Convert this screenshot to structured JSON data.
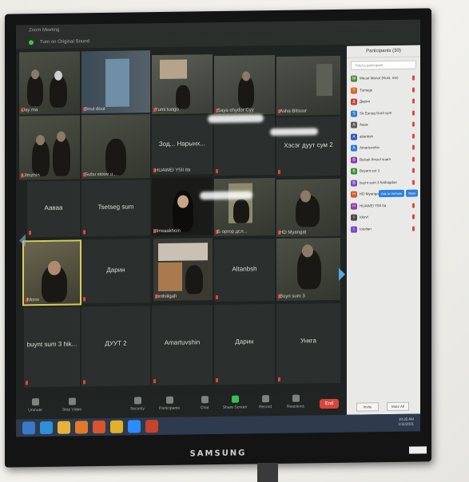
{
  "screen": {
    "title_text": "Zoom Meeting",
    "banner_text": "Turn on Original Sound"
  },
  "gallery": {
    "video_tiles": [
      {
        "name": "Jay ma"
      },
      {
        "name": "Bout dout"
      },
      {
        "name": "Tumi tungo"
      },
      {
        "name": "Saya ehydor Cyy"
      },
      {
        "name": "Asha Bitsuur"
      },
      {
        "name": "Ulmzhin"
      },
      {
        "name": "Subu stoov u..."
      },
      {
        "name": "HUAWEI Y5II Ita"
      },
      {
        "name": "Ilmsaakhoin"
      },
      {
        "name": "Б оргор дсл..."
      },
      {
        "name": "HD Myangat"
      },
      {
        "name": "Mono"
      },
      {
        "name": "Iinthiilgah"
      },
      {
        "name": "Buyn sum 3"
      }
    ],
    "name_tiles": [
      {
        "name": "Хэсэг дуут сум 2"
      },
      {
        "name": "Ааваа"
      },
      {
        "name": "Tsetseg sum"
      },
      {
        "name": "Дарин"
      },
      {
        "name": "Altanbsh"
      },
      {
        "name": "buynt sum 3 hik..."
      },
      {
        "name": "ДУУТ 2"
      },
      {
        "name": "Amartuvshin"
      },
      {
        "name": "Дарин"
      },
      {
        "name": "Ункгa"
      }
    ],
    "overlay_caption": "Зод... Нарынх..."
  },
  "toolbar": {
    "items": [
      {
        "label": "Unmute",
        "icon": "microphone-icon"
      },
      {
        "label": "Stop Video",
        "icon": "video-camera-icon"
      },
      {
        "label": "Security",
        "icon": "shield-icon"
      },
      {
        "label": "Participants",
        "icon": "participants-icon",
        "count": "30"
      },
      {
        "label": "Chat",
        "icon": "chat-icon"
      },
      {
        "label": "Share Screen",
        "icon": "share-screen-icon"
      },
      {
        "label": "Record",
        "icon": "record-icon"
      },
      {
        "label": "Reactions",
        "icon": "reactions-icon"
      }
    ],
    "end_label": "End"
  },
  "participants": {
    "title": "Participants (30)",
    "search_placeholder": "Find a participant",
    "ask_unmute_label": "Ask to Unmute",
    "more_label": "More",
    "list": [
      {
        "initial": "M",
        "name": "Mnout Monot (Host, me)",
        "color": "#4f8b3c"
      },
      {
        "initial": "T",
        "name": "Tumegs",
        "color": "#d2692a"
      },
      {
        "initial": "Д",
        "name": "Дарин",
        "color": "#c23d3a"
      },
      {
        "initial": "S",
        "name": "Sh Eunog Gorit sym",
        "color": "#2f7ad3"
      },
      {
        "initial": "A",
        "name": "Aaua",
        "color": "#5a5a5a"
      },
      {
        "initial": "A",
        "name": "altanbsh",
        "color": "#2f5ab8"
      },
      {
        "initial": "A",
        "name": "Amartuvshin",
        "color": "#2f7ad3"
      },
      {
        "initial": "B",
        "name": "Bulsuk Ihnzel suam",
        "color": "#8b3da6"
      },
      {
        "initial": "B",
        "name": "Buyant sur 1",
        "color": "#3d8f3a"
      },
      {
        "initial": "B",
        "name": "buynt sum 3 hathagdas",
        "color": "#7a4cc0"
      },
      {
        "initial": "H",
        "name": "HD Myangat",
        "color": "#d05a2a"
      },
      {
        "initial": "H",
        "name": "HUAWEI Y5II Ita",
        "color": "#8b3da6"
      },
      {
        "initial": "I",
        "name": "Idsrvl",
        "color": "#4a4a4a"
      },
      {
        "initial": "I",
        "name": "Iotofian",
        "color": "#7a4cc0"
      }
    ],
    "invite_label": "Invite",
    "mute_all_label": "Mute All"
  },
  "taskbar": {
    "apps": [
      {
        "icon": "windows-start-icon",
        "color": "#3a78c9"
      },
      {
        "icon": "internet-explorer-icon",
        "color": "#2f8fd8"
      },
      {
        "icon": "file-explorer-icon",
        "color": "#e6b23a"
      },
      {
        "icon": "media-player-icon",
        "color": "#e07a2a"
      },
      {
        "icon": "firefox-icon",
        "color": "#d9542b"
      },
      {
        "icon": "chrome-icon",
        "color": "#e0b12a"
      },
      {
        "icon": "zoom-icon",
        "color": "#2d8cff"
      },
      {
        "icon": "powerpoint-icon",
        "color": "#c8432b"
      }
    ],
    "time": "10:35 AM",
    "date": "1/11/2021"
  },
  "monitor": {
    "brand": "SAMSUNG"
  }
}
